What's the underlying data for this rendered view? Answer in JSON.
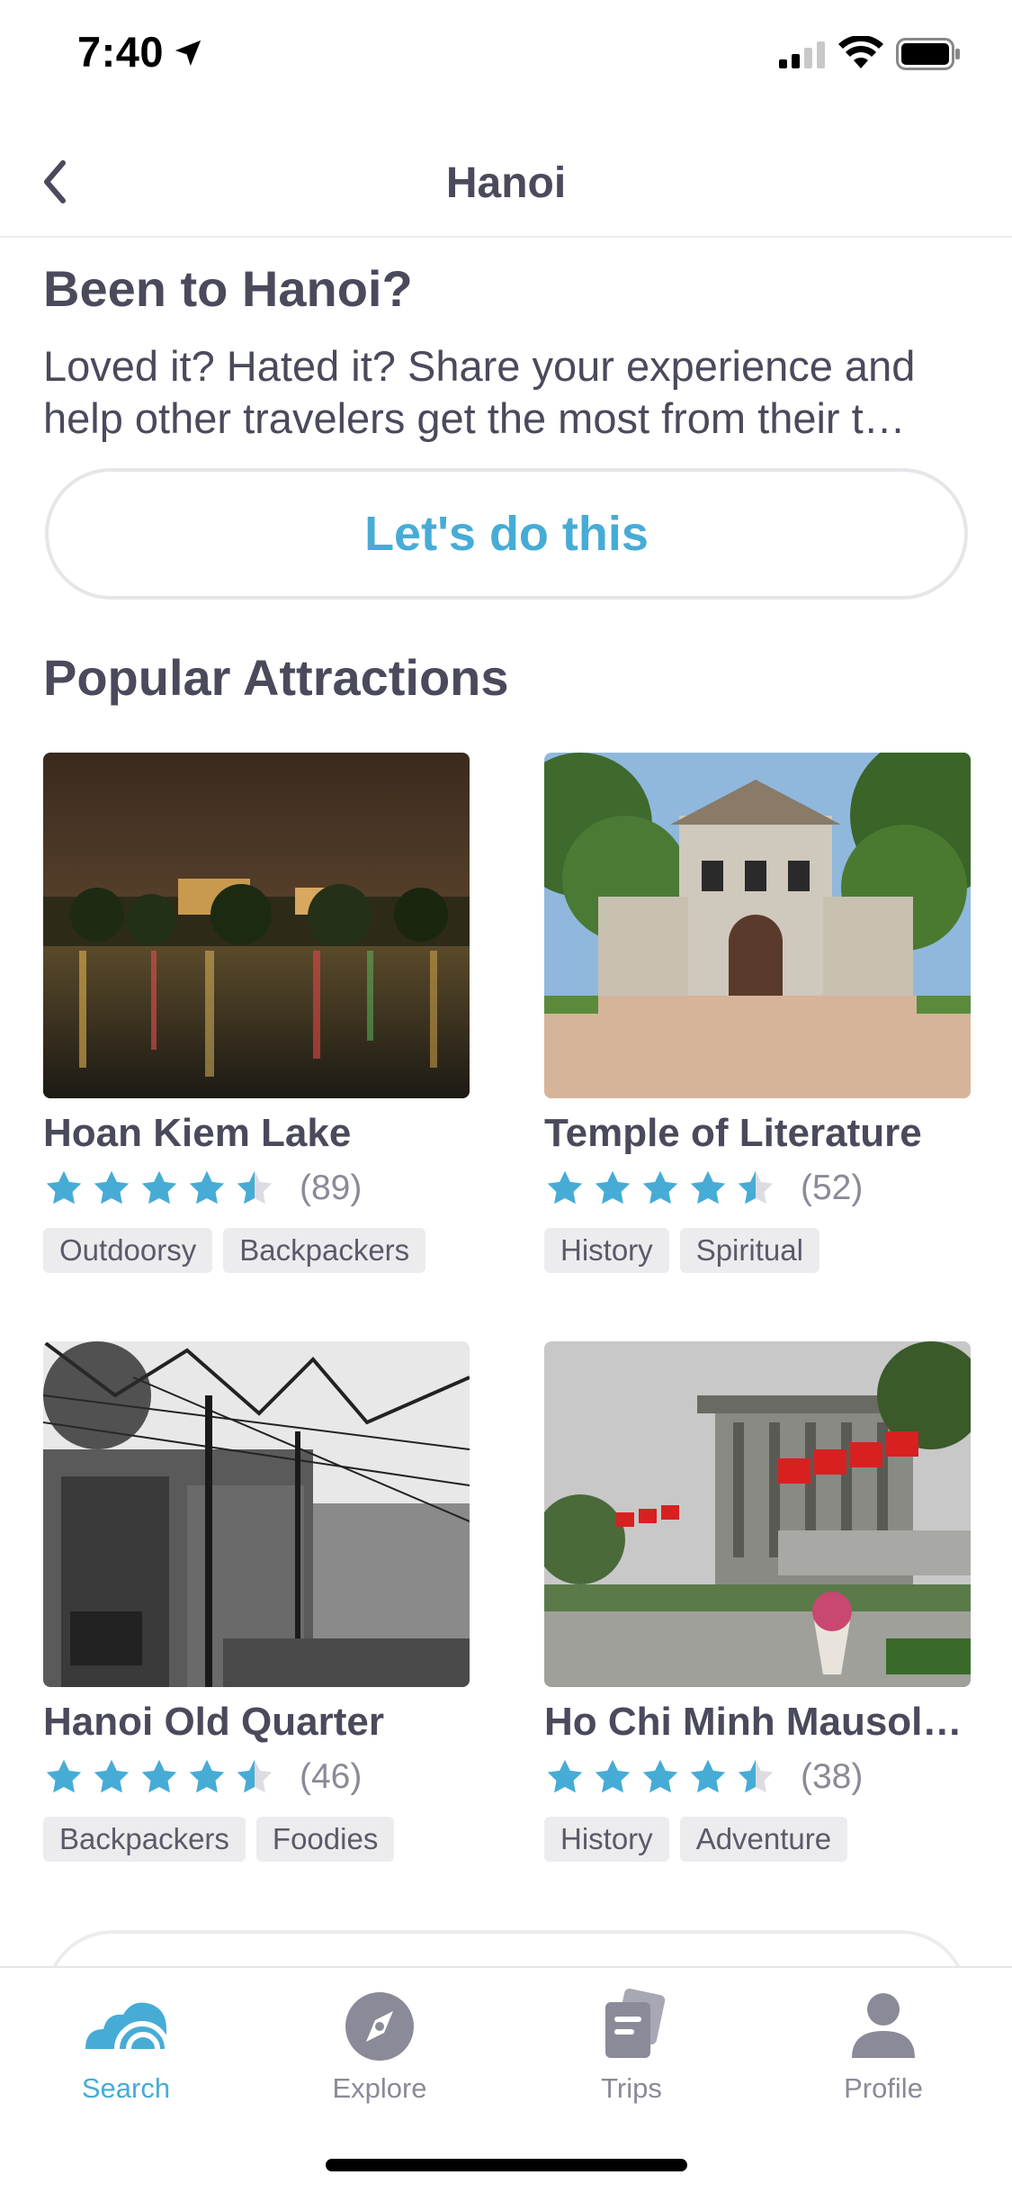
{
  "status_bar": {
    "time": "7:40"
  },
  "nav": {
    "title": "Hanoi"
  },
  "been": {
    "title": "Been to Hanoi?",
    "description": "Loved it? Hated it? Share your experience and help other travelers get the most from their t…",
    "cta": "Let's do this"
  },
  "section": {
    "title": "Popular Attractions"
  },
  "attractions": [
    {
      "name": "Hoan Kiem Lake",
      "rating": 4.5,
      "count": "(89)",
      "tags": [
        "Outdoorsy",
        "Backpackers"
      ]
    },
    {
      "name": "Temple of Literature",
      "rating": 4.5,
      "count": "(52)",
      "tags": [
        "History",
        "Spiritual"
      ]
    },
    {
      "name": "Hanoi Old Quarter",
      "rating": 4.5,
      "count": "(46)",
      "tags": [
        "Backpackers",
        "Foodies"
      ]
    },
    {
      "name": "Ho Chi Minh Mausol…",
      "rating": 4.5,
      "count": "(38)",
      "tags": [
        "History",
        "Adventure"
      ]
    }
  ],
  "tabs": [
    {
      "label": "Search",
      "icon": "search-waves-icon",
      "active": true
    },
    {
      "label": "Explore",
      "icon": "compass-icon",
      "active": false
    },
    {
      "label": "Trips",
      "icon": "trips-cards-icon",
      "active": false
    },
    {
      "label": "Profile",
      "icon": "profile-icon",
      "active": false
    }
  ],
  "colors": {
    "accent": "#46acd6",
    "text": "#4a4a5c",
    "muted": "#8a8a98",
    "tag_bg": "#ececef"
  }
}
